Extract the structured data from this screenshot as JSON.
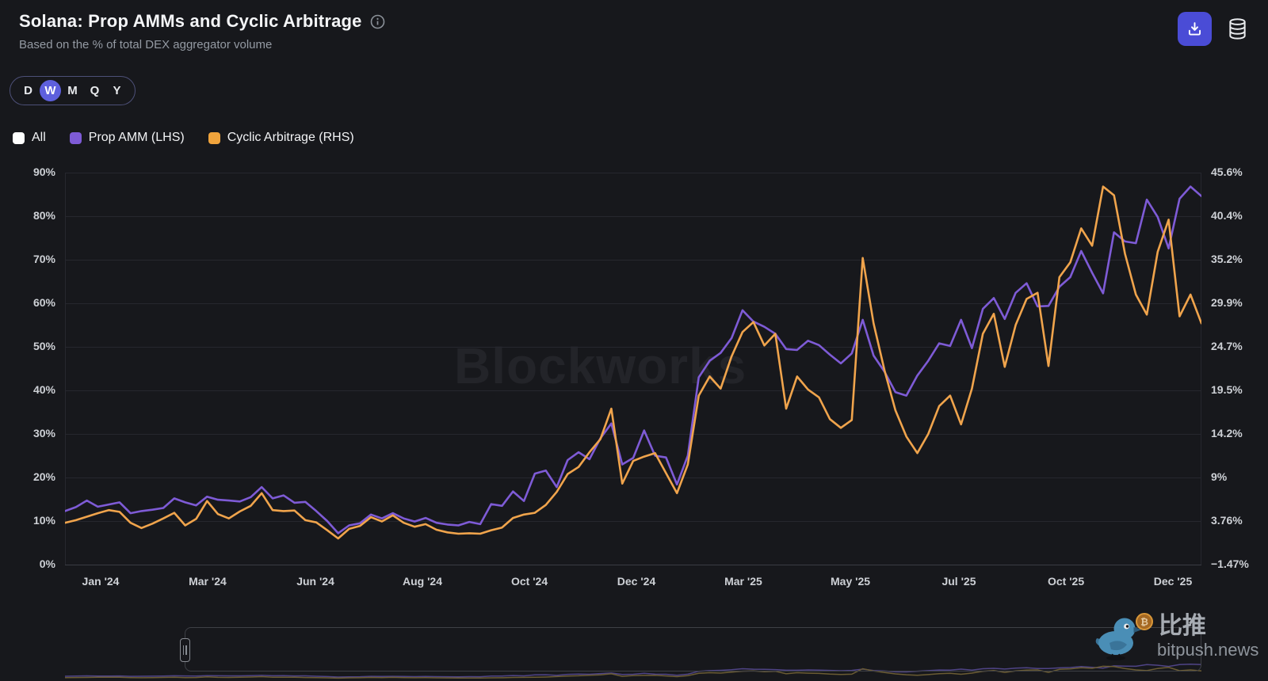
{
  "header": {
    "title": "Solana: Prop AMMs and Cyclic Arbitrage",
    "subtitle": "Based on the % of total DEX aggregator volume"
  },
  "toolbar": {
    "download_icon": "download-icon",
    "database_icon": "database-icon"
  },
  "period_selector": {
    "options": [
      "D",
      "W",
      "M",
      "Q",
      "Y"
    ],
    "selected": "W"
  },
  "legend": [
    {
      "label": "All",
      "color": "#ffffff"
    },
    {
      "label": "Prop AMM (LHS)",
      "color": "#7e5bd6"
    },
    {
      "label": "Cyclic Arbitrage (RHS)",
      "color": "#f0a43c"
    }
  ],
  "watermark": {
    "text": "Blockworks"
  },
  "footer_watermark": {
    "cjk": "比推",
    "site": "bitpush.news",
    "coin_symbol": "₿"
  },
  "chart_data": {
    "type": "line",
    "title": "Solana: Prop AMMs and Cyclic Arbitrage",
    "x_unit": "week",
    "x_range": [
      "Jan '24",
      "Dec '25"
    ],
    "x_ticks": [
      {
        "label": "Jan '24",
        "f": 0.0314
      },
      {
        "label": "Mar '24",
        "f": 0.1255
      },
      {
        "label": "Jun '24",
        "f": 0.2204
      },
      {
        "label": "Aug '24",
        "f": 0.3145
      },
      {
        "label": "Oct '24",
        "f": 0.4087
      },
      {
        "label": "Dec '24",
        "f": 0.5028
      },
      {
        "label": "Mar '25",
        "f": 0.5969
      },
      {
        "label": "May '25",
        "f": 0.6911
      },
      {
        "label": "Jul '25",
        "f": 0.7866
      },
      {
        "label": "Oct '25",
        "f": 0.8808
      },
      {
        "label": "Dec '25",
        "f": 0.9749
      }
    ],
    "left_axis": {
      "min": 0,
      "max": 90,
      "tick_values": [
        0,
        10,
        20,
        30,
        40,
        50,
        60,
        70,
        80,
        90
      ],
      "tick_labels": [
        "0%",
        "10%",
        "20%",
        "30%",
        "40%",
        "50%",
        "60%",
        "70%",
        "80%",
        "90%"
      ]
    },
    "right_axis": {
      "min": -1.47,
      "max": 45.6,
      "tick_labels": [
        "−1.47%",
        "3.76%",
        "9%",
        "14.2%",
        "19.5%",
        "24.7%",
        "29.9%",
        "35.2%",
        "40.4%",
        "45.6%"
      ]
    },
    "grid": true,
    "legend_position": "top-left",
    "series": [
      {
        "name": "Prop AMM (LHS)",
        "axis": "left",
        "color": "#7e5bd6",
        "values": [
          12.3,
          13.2,
          14.7,
          13.3,
          13.8,
          14.3,
          11.8,
          12.3,
          12.6,
          13.0,
          15.2,
          14.3,
          13.6,
          15.6,
          14.9,
          14.7,
          14.5,
          15.5,
          17.8,
          15.2,
          15.9,
          14.2,
          14.4,
          12.3,
          10.0,
          7.2,
          9.0,
          9.5,
          11.5,
          10.6,
          11.8,
          10.6,
          9.9,
          10.7,
          9.6,
          9.2,
          9.0,
          9.8,
          9.3,
          13.9,
          13.5,
          16.8,
          14.6,
          20.9,
          21.6,
          17.8,
          24.0,
          25.8,
          24.2,
          29.0,
          32.4,
          23.0,
          24.5,
          30.8,
          25.0,
          24.6,
          18.4,
          25.0,
          43.0,
          46.8,
          48.6,
          52.0,
          58.4,
          55.8,
          54.6,
          53.0,
          49.5,
          49.3,
          51.4,
          50.4,
          48.2,
          46.2,
          48.5,
          56.2,
          48.0,
          44.3,
          39.6,
          38.8,
          43.4,
          46.8,
          50.8,
          50.2,
          56.2,
          49.7,
          58.7,
          61.2,
          56.4,
          62.4,
          64.6,
          59.3,
          59.4,
          63.8,
          66.0,
          72.0,
          67.0,
          62.3,
          76.3,
          74.2,
          73.8,
          83.8,
          79.8,
          72.6,
          84.0,
          86.8,
          84.6
        ]
      },
      {
        "name": "Cyclic Arbitrage (RHS)",
        "axis": "right",
        "color": "#f0a44c",
        "values": [
          3.55,
          3.86,
          4.28,
          4.7,
          5.07,
          4.86,
          3.55,
          2.92,
          3.45,
          4.07,
          4.75,
          3.24,
          4.02,
          6.17,
          4.6,
          4.07,
          4.91,
          5.59,
          7.11,
          5.07,
          4.96,
          5.02,
          3.86,
          3.6,
          2.66,
          1.67,
          2.82,
          3.18,
          4.23,
          3.71,
          4.44,
          3.55,
          3.08,
          3.39,
          2.71,
          2.4,
          2.24,
          2.3,
          2.24,
          2.66,
          2.98,
          4.13,
          4.54,
          4.75,
          5.69,
          7.26,
          9.41,
          10.25,
          12.02,
          13.59,
          17.25,
          8.26,
          10.98,
          11.5,
          11.92,
          9.51,
          7.11,
          10.56,
          18.82,
          21.12,
          19.66,
          23.53,
          26.46,
          27.66,
          24.84,
          26.25,
          17.25,
          21.12,
          19.55,
          18.61,
          16.0,
          14.95,
          15.89,
          35.35,
          27.5,
          21.86,
          17.04,
          13.91,
          11.92,
          14.22,
          17.57,
          18.82,
          15.37,
          19.66,
          26.25,
          28.65,
          22.27,
          27.3,
          30.43,
          31.17,
          22.38,
          33.05,
          34.83,
          38.91,
          36.82,
          43.93,
          42.88,
          35.87,
          30.96,
          28.55,
          36.08,
          39.95,
          28.34,
          30.96,
          27.5
        ]
      }
    ]
  },
  "navigator": {
    "range_start_frac": 0.1053,
    "range_end_frac": 1.0,
    "dim_colors": {
      "purple": "#4f4486",
      "orange": "#6b5c33"
    }
  }
}
